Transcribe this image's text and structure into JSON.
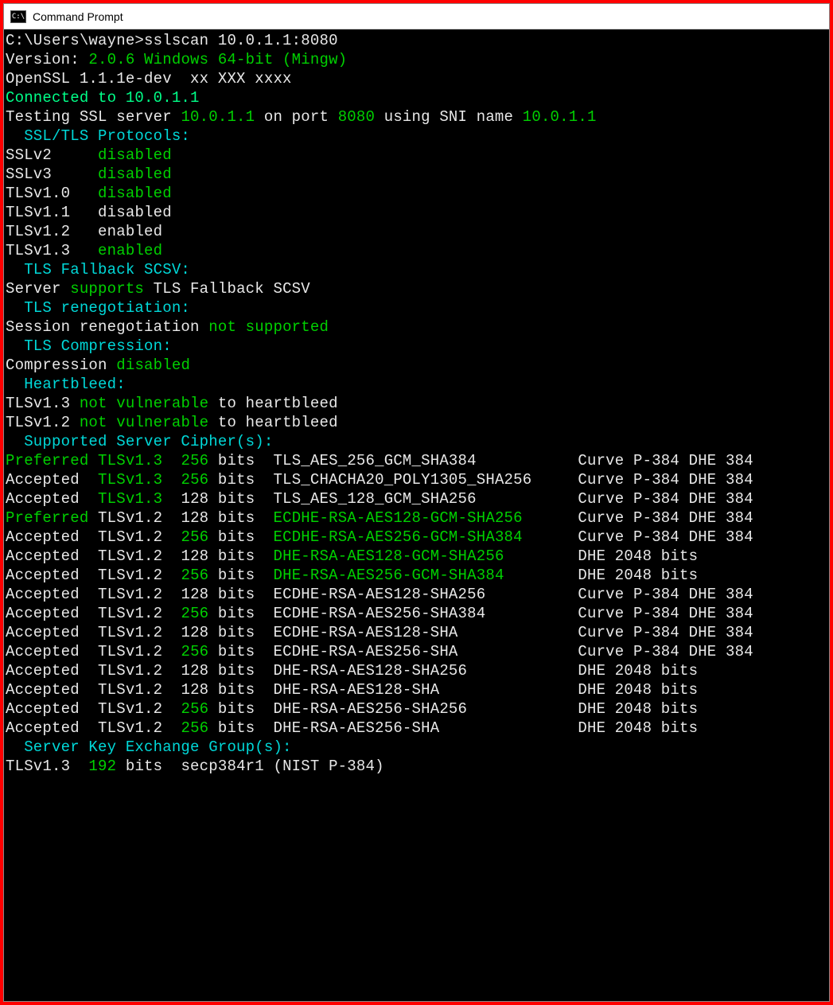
{
  "window": {
    "title": "Command Prompt"
  },
  "prompt": "C:\\Users\\wayne>",
  "command": "sslscan 10.0.1.1:8080",
  "version_label": "Version:",
  "version_value": "2.0.6 Windows 64-bit (Mingw)",
  "openssl_line": "OpenSSL 1.1.1e-dev  xx XXX xxxx",
  "connected": "Connected to 10.0.1.1",
  "testing": {
    "pre": "Testing SSL server ",
    "host": "10.0.1.1",
    "mid1": " on port ",
    "port": "8080",
    "mid2": " using SNI name ",
    "sni": "10.0.1.1"
  },
  "h_protocols": "  SSL/TLS Protocols:",
  "protocols": [
    {
      "name": "SSLv2",
      "pad": "     ",
      "status": "disabled",
      "color": "g"
    },
    {
      "name": "SSLv3",
      "pad": "     ",
      "status": "disabled",
      "color": "g"
    },
    {
      "name": "TLSv1.0",
      "pad": "   ",
      "status": "disabled",
      "color": "g"
    },
    {
      "name": "TLSv1.1",
      "pad": "   ",
      "status": "disabled",
      "color": "w"
    },
    {
      "name": "TLSv1.2",
      "pad": "   ",
      "status": "enabled",
      "color": "w"
    },
    {
      "name": "TLSv1.3",
      "pad": "   ",
      "status": "enabled",
      "color": "g"
    }
  ],
  "h_fallback": "  TLS Fallback SCSV:",
  "fallback": {
    "pre": "Server ",
    "verb": "supports",
    "post": " TLS Fallback SCSV"
  },
  "h_reneg": "  TLS renegotiation:",
  "reneg": {
    "pre": "Session renegotiation ",
    "verb": "not supported"
  },
  "h_compression": "  TLS Compression:",
  "compression": {
    "pre": "Compression ",
    "verb": "disabled"
  },
  "h_heartbleed": "  Heartbleed:",
  "heartbleed": [
    {
      "tls": "TLSv1.3 ",
      "verb": "not vulnerable",
      "post": " to heartbleed"
    },
    {
      "tls": "TLSv1.2 ",
      "verb": "not vulnerable",
      "post": " to heartbleed"
    }
  ],
  "h_ciphers": "  Supported Server Cipher(s):",
  "ciphers": [
    {
      "status": "Preferred",
      "sc": "g",
      "tls": "TLSv1.3",
      "tc": "g",
      "bits": "256",
      "bc": "g",
      "suite": "TLS_AES_256_GCM_SHA384           ",
      "suc": "w",
      "curve": "Curve P-384 DHE 384"
    },
    {
      "status": "Accepted ",
      "sc": "w",
      "tls": "TLSv1.3",
      "tc": "g",
      "bits": "256",
      "bc": "g",
      "suite": "TLS_CHACHA20_POLY1305_SHA256     ",
      "suc": "w",
      "curve": "Curve P-384 DHE 384"
    },
    {
      "status": "Accepted ",
      "sc": "w",
      "tls": "TLSv1.3",
      "tc": "g",
      "bits": "128",
      "bc": "w",
      "suite": "TLS_AES_128_GCM_SHA256           ",
      "suc": "w",
      "curve": "Curve P-384 DHE 384"
    },
    {
      "status": "Preferred",
      "sc": "g",
      "tls": "TLSv1.2",
      "tc": "w",
      "bits": "128",
      "bc": "w",
      "suite": "ECDHE-RSA-AES128-GCM-SHA256      ",
      "suc": "g",
      "curve": "Curve P-384 DHE 384"
    },
    {
      "status": "Accepted ",
      "sc": "w",
      "tls": "TLSv1.2",
      "tc": "w",
      "bits": "256",
      "bc": "g",
      "suite": "ECDHE-RSA-AES256-GCM-SHA384      ",
      "suc": "g",
      "curve": "Curve P-384 DHE 384"
    },
    {
      "status": "Accepted ",
      "sc": "w",
      "tls": "TLSv1.2",
      "tc": "w",
      "bits": "128",
      "bc": "w",
      "suite": "DHE-RSA-AES128-GCM-SHA256        ",
      "suc": "g",
      "curve": "DHE 2048 bits"
    },
    {
      "status": "Accepted ",
      "sc": "w",
      "tls": "TLSv1.2",
      "tc": "w",
      "bits": "256",
      "bc": "g",
      "suite": "DHE-RSA-AES256-GCM-SHA384        ",
      "suc": "g",
      "curve": "DHE 2048 bits"
    },
    {
      "status": "Accepted ",
      "sc": "w",
      "tls": "TLSv1.2",
      "tc": "w",
      "bits": "128",
      "bc": "w",
      "suite": "ECDHE-RSA-AES128-SHA256          ",
      "suc": "w",
      "curve": "Curve P-384 DHE 384"
    },
    {
      "status": "Accepted ",
      "sc": "w",
      "tls": "TLSv1.2",
      "tc": "w",
      "bits": "256",
      "bc": "g",
      "suite": "ECDHE-RSA-AES256-SHA384          ",
      "suc": "w",
      "curve": "Curve P-384 DHE 384"
    },
    {
      "status": "Accepted ",
      "sc": "w",
      "tls": "TLSv1.2",
      "tc": "w",
      "bits": "128",
      "bc": "w",
      "suite": "ECDHE-RSA-AES128-SHA             ",
      "suc": "w",
      "curve": "Curve P-384 DHE 384"
    },
    {
      "status": "Accepted ",
      "sc": "w",
      "tls": "TLSv1.2",
      "tc": "w",
      "bits": "256",
      "bc": "g",
      "suite": "ECDHE-RSA-AES256-SHA             ",
      "suc": "w",
      "curve": "Curve P-384 DHE 384"
    },
    {
      "status": "Accepted ",
      "sc": "w",
      "tls": "TLSv1.2",
      "tc": "w",
      "bits": "128",
      "bc": "w",
      "suite": "DHE-RSA-AES128-SHA256            ",
      "suc": "w",
      "curve": "DHE 2048 bits"
    },
    {
      "status": "Accepted ",
      "sc": "w",
      "tls": "TLSv1.2",
      "tc": "w",
      "bits": "128",
      "bc": "w",
      "suite": "DHE-RSA-AES128-SHA               ",
      "suc": "w",
      "curve": "DHE 2048 bits"
    },
    {
      "status": "Accepted ",
      "sc": "w",
      "tls": "TLSv1.2",
      "tc": "w",
      "bits": "256",
      "bc": "g",
      "suite": "DHE-RSA-AES256-SHA256            ",
      "suc": "w",
      "curve": "DHE 2048 bits"
    },
    {
      "status": "Accepted ",
      "sc": "w",
      "tls": "TLSv1.2",
      "tc": "w",
      "bits": "256",
      "bc": "g",
      "suite": "DHE-RSA-AES256-SHA               ",
      "suc": "w",
      "curve": "DHE 2048 bits"
    }
  ],
  "h_keygroup": "  Server Key Exchange Group(s):",
  "keygroup": {
    "tls": "TLSv1.3  ",
    "bits": "192",
    "bits_label": " bits  ",
    "name": "secp384r1 (NIST P-384)"
  }
}
